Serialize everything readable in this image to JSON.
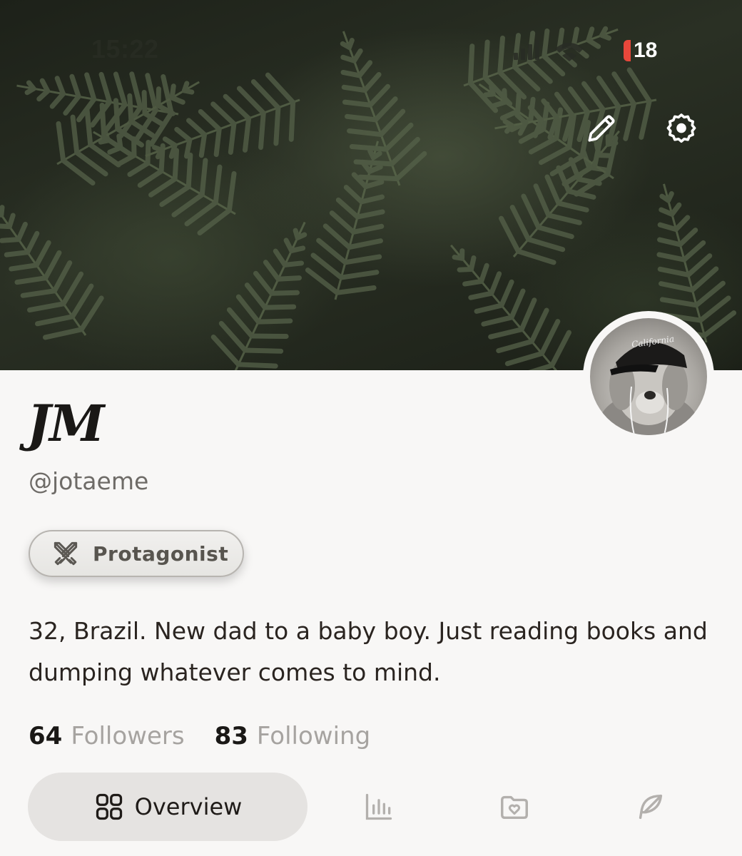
{
  "status_bar": {
    "time": "15:22",
    "battery_level": "18",
    "battery_color": "#e8473b"
  },
  "cover": {
    "edit_icon": "pencil-icon",
    "settings_icon": "gear-icon"
  },
  "profile": {
    "display_name": "JM",
    "handle": "@jotaeme",
    "avatar_cap_text": "California",
    "badge": {
      "icon": "crossed-swords-icon",
      "label": "Protagonist"
    },
    "bio": "32, Brazil. New dad to a baby boy. Just reading books and dumping whatever comes to mind.",
    "followers": {
      "count": "64",
      "label": "Followers"
    },
    "following": {
      "count": "83",
      "label": "Following"
    }
  },
  "tabs": [
    {
      "id": "overview",
      "label": "Overview",
      "icon": "grid-icon",
      "active": true
    },
    {
      "id": "stats",
      "icon": "bar-chart-icon",
      "active": false
    },
    {
      "id": "collections",
      "icon": "folder-heart-icon",
      "active": false
    },
    {
      "id": "writing",
      "icon": "feather-icon",
      "active": false
    }
  ]
}
